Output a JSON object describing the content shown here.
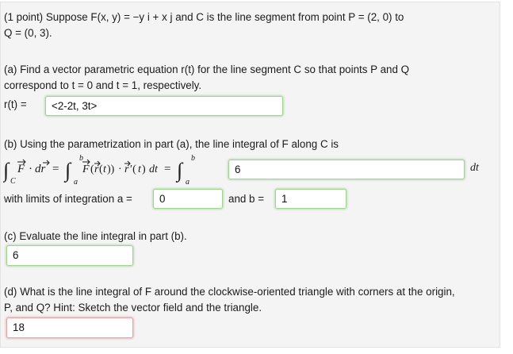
{
  "problem": {
    "intro_line1": "(1 point) Suppose F(x, y) = −y i + x j and C is the line segment from point P = (2, 0) to",
    "intro_line2": "Q = (0, 3).",
    "part_a_line1": "(a) Find a vector parametric equation r(t) for the line segment C so that points P and Q",
    "part_a_line2": "correspond to t = 0 and t = 1, respectively.",
    "part_a_label": "r(t) =",
    "part_a_answer": "<2-2t, 3t>",
    "part_b_line": "(b) Using the parametrization in part (a), the line integral of F along C is",
    "part_b_answer": "6",
    "part_b_dt": "dt",
    "limits_label": "with limits of integration a =",
    "limit_a": "0",
    "limits_and": "and b =",
    "limit_b": "1",
    "part_c_line": "(c) Evaluate the line integral in part (b).",
    "part_c_answer": "6",
    "part_d_line1": "(d) What is the line integral of F around the clockwise-oriented triangle with corners at the origin,",
    "part_d_line2": "P, and Q? Hint: Sketch the vector field and the triangle.",
    "part_d_answer": "18"
  },
  "colors": {
    "correct_border": "#9fd58f",
    "incorrect_border": "#e9a1a1",
    "panel_bg": "#f4f4f4"
  }
}
